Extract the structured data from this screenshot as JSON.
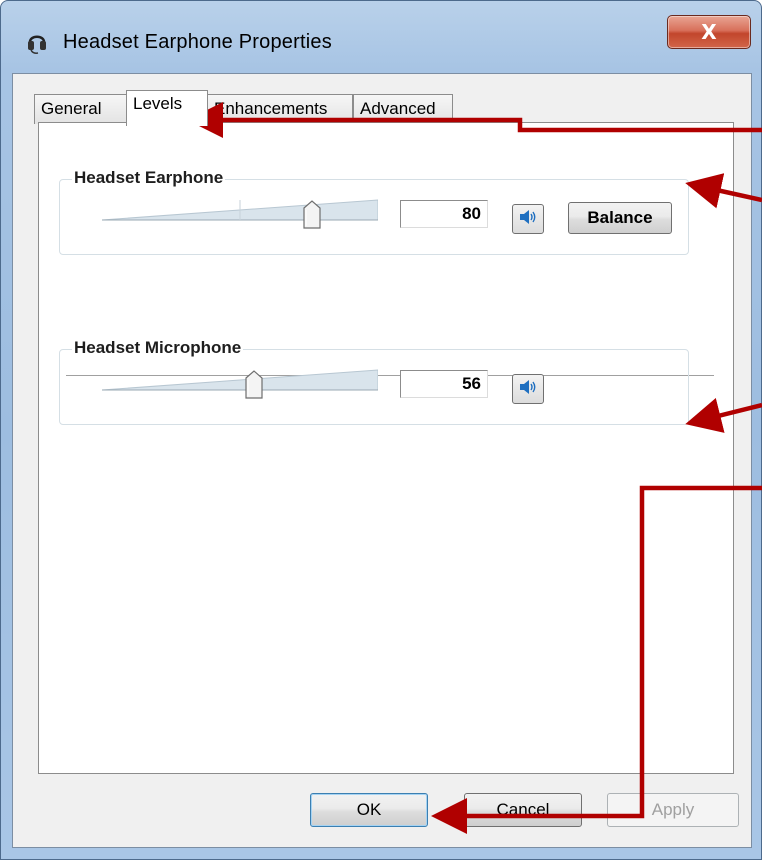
{
  "window": {
    "title": "Headset Earphone Properties",
    "close_label": "X",
    "icon": "headset-icon"
  },
  "tabs": [
    {
      "label": "General",
      "active": false
    },
    {
      "label": "Levels",
      "active": true
    },
    {
      "label": "Enhancements",
      "active": false
    },
    {
      "label": "Advanced",
      "active": false
    }
  ],
  "levels": {
    "earphone": {
      "label": "Headset Earphone",
      "value": "80",
      "level": 80,
      "speaker_icon": "speaker-icon",
      "balance_label": "Balance"
    },
    "microphone": {
      "label": "Headset Microphone",
      "value": "56",
      "level": 56,
      "speaker_icon": "speaker-icon"
    }
  },
  "footer": {
    "ok_label": "OK",
    "cancel_label": "Cancel",
    "apply_label": "Apply"
  },
  "colors": {
    "annotation_arrow": "#b00000",
    "speaker_blue": "#1f6fc0",
    "close_red": "#c7452c"
  }
}
